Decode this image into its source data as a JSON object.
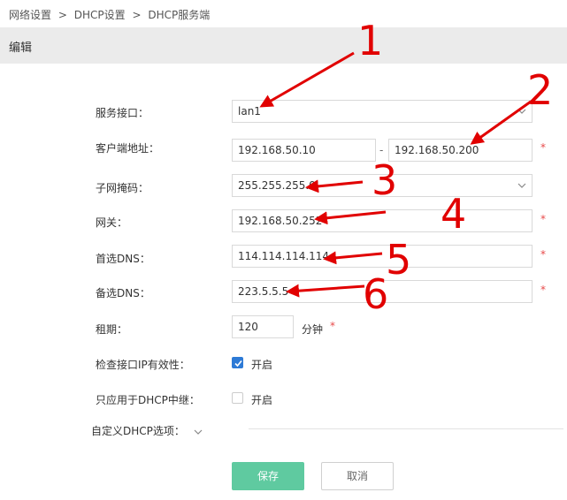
{
  "breadcrumb": [
    "网络设置",
    "DHCP设置",
    "DHCP服务端"
  ],
  "breadcrumb_sep": ">",
  "section_title": "编辑",
  "form": {
    "interface": {
      "label": "服务接口：",
      "value": "lan1"
    },
    "client_range": {
      "label": "客户端地址：",
      "start": "192.168.50.10",
      "dash": "-",
      "end": "192.168.50.200"
    },
    "netmask": {
      "label": "子网掩码：",
      "value": "255.255.255.0"
    },
    "gateway": {
      "label": "网关：",
      "value": "192.168.50.252"
    },
    "primary_dns": {
      "label": "首选DNS：",
      "value": "114.114.114.114"
    },
    "secondary_dns": {
      "label": "备选DNS：",
      "value": "223.5.5.5"
    },
    "lease": {
      "label": "租期：",
      "value": "120",
      "unit": "分钟"
    },
    "check_ip": {
      "label": "检查接口IP有效性：",
      "option": "开启",
      "checked": true
    },
    "relay_only": {
      "label": "只应用于DHCP中继：",
      "option": "开启",
      "checked": false
    },
    "custom_options": {
      "label": "自定义DHCP选项："
    },
    "required_mark": "*"
  },
  "buttons": {
    "save": "保存",
    "cancel": "取消"
  },
  "annotations": {
    "n1": "1",
    "n2": "2",
    "n3": "3",
    "n4": "4",
    "n5": "5",
    "n6": "6"
  },
  "colors": {
    "annotation": "#e10000",
    "save_button": "#5fcaa0",
    "checkbox_checked": "#2d7ad6",
    "required": "#e84a4a"
  }
}
